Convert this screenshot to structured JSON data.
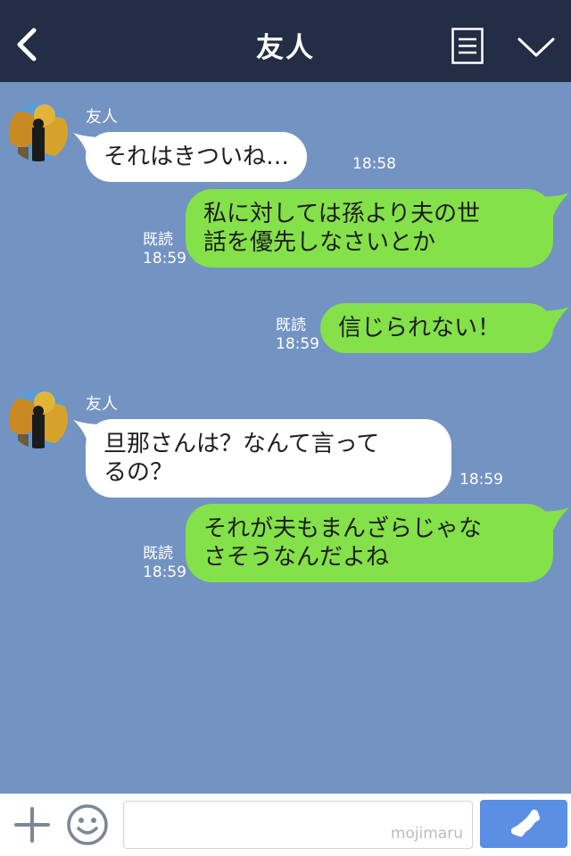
{
  "header": {
    "title": "友人",
    "back_icon": "chevron-left-icon",
    "menu_icon": "menu-lines-icon",
    "collapse_icon": "chevron-down-icon"
  },
  "messages": [
    {
      "sender": "友人",
      "text": "それはきついね…",
      "time": "18:58"
    },
    {
      "text": "私に対しては孫より夫の世\n話を優先しなさいとか",
      "read": "既読",
      "time": "18:59"
    },
    {
      "text": "信じられない！",
      "read": "既読",
      "time": "18:59"
    },
    {
      "sender": "友人",
      "text": "旦那さんは？なんて言って\nるの？",
      "time": "18:59"
    },
    {
      "text": "それが夫もまんざらじゃな\nさそうなんだよね",
      "read": "既読",
      "time": "18:59"
    }
  ],
  "footer": {
    "input_value": "",
    "watermark": "mojimaru",
    "plus_icon": "plus-icon",
    "emoji_icon": "smiley-icon",
    "call_icon": "phone-icon"
  },
  "colors": {
    "header_bg": "#232d45",
    "chat_bg": "#7393c3",
    "outgoing_bubble": "#84e14a",
    "incoming_bubble": "#ffffff",
    "call_button": "#5a8fe4"
  }
}
